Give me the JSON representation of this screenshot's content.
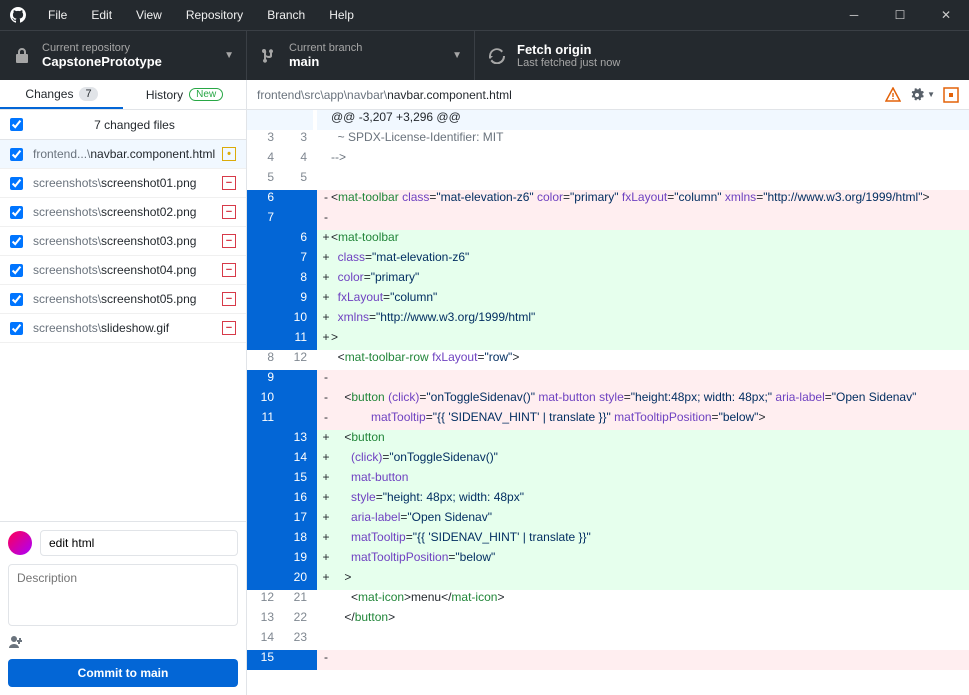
{
  "menu": [
    "File",
    "Edit",
    "View",
    "Repository",
    "Branch",
    "Help"
  ],
  "toolbar": {
    "repo_label": "Current repository",
    "repo_value": "CapstonePrototype",
    "branch_label": "Current branch",
    "branch_value": "main",
    "fetch_label": "Fetch origin",
    "fetch_value": "Last fetched just now"
  },
  "tabs": {
    "changes": "Changes",
    "changes_count": "7",
    "history": "History",
    "new_label": "New"
  },
  "files_header": "7 changed files",
  "files": [
    {
      "dim": "frontend...\\",
      "name": "navbar.component.html",
      "status": "modified"
    },
    {
      "dim": "screenshots\\",
      "name": "screenshot01.png",
      "status": "deleted"
    },
    {
      "dim": "screenshots\\",
      "name": "screenshot02.png",
      "status": "deleted"
    },
    {
      "dim": "screenshots\\",
      "name": "screenshot03.png",
      "status": "deleted"
    },
    {
      "dim": "screenshots\\",
      "name": "screenshot04.png",
      "status": "deleted"
    },
    {
      "dim": "screenshots\\",
      "name": "screenshot05.png",
      "status": "deleted"
    },
    {
      "dim": "screenshots\\",
      "name": "slideshow.gif",
      "status": "deleted"
    }
  ],
  "commit": {
    "summary_value": "edit html",
    "desc_placeholder": "Description",
    "button_prefix": "Commit to ",
    "button_branch": "main"
  },
  "path": {
    "dim": "frontend\\src\\app\\navbar\\",
    "file": "navbar.component.html"
  },
  "diff": [
    {
      "type": "hunk",
      "l": "",
      "r": "",
      "tokens": [
        {
          "c": "p",
          "t": "@@ -3,207 +3,296 @@"
        }
      ]
    },
    {
      "type": "ctx",
      "l": "3",
      "r": "3",
      "tokens": [
        {
          "c": "c",
          "t": "  ~ SPDX-License-Identifier: MIT"
        }
      ]
    },
    {
      "type": "ctx",
      "l": "4",
      "r": "4",
      "tokens": [
        {
          "c": "c",
          "t": "-->"
        }
      ]
    },
    {
      "type": "ctx",
      "l": "5",
      "r": "5",
      "tokens": []
    },
    {
      "type": "del",
      "l": "6",
      "r": "",
      "tokens": [
        {
          "c": "p",
          "t": "<"
        },
        {
          "c": "t",
          "t": "mat-toolbar"
        },
        {
          "c": "p",
          "t": " "
        },
        {
          "c": "a",
          "t": "class"
        },
        {
          "c": "p",
          "t": "="
        },
        {
          "c": "s",
          "t": "\"mat-elevation-z6\""
        },
        {
          "c": "p",
          "t": " "
        },
        {
          "c": "a",
          "t": "color"
        },
        {
          "c": "p",
          "t": "="
        },
        {
          "c": "s",
          "t": "\"primary\""
        },
        {
          "c": "p",
          "t": " "
        },
        {
          "c": "a",
          "t": "fxLayout"
        },
        {
          "c": "p",
          "t": "="
        },
        {
          "c": "s",
          "t": "\"column\""
        },
        {
          "c": "p",
          "t": " "
        },
        {
          "c": "a",
          "t": "xmlns"
        },
        {
          "c": "p",
          "t": "="
        },
        {
          "c": "s",
          "t": "\"http://www.w3.org/1999/html\""
        },
        {
          "c": "p",
          "t": ">"
        }
      ]
    },
    {
      "type": "del",
      "l": "7",
      "r": "",
      "tokens": []
    },
    {
      "type": "add",
      "l": "",
      "r": "6",
      "tokens": [
        {
          "c": "p",
          "t": "<"
        },
        {
          "c": "t",
          "t": "mat-toolbar"
        }
      ]
    },
    {
      "type": "add",
      "l": "",
      "r": "7",
      "tokens": [
        {
          "c": "p",
          "t": "  "
        },
        {
          "c": "a",
          "t": "class"
        },
        {
          "c": "p",
          "t": "="
        },
        {
          "c": "s",
          "t": "\"mat-elevation-z6\""
        }
      ]
    },
    {
      "type": "add",
      "l": "",
      "r": "8",
      "tokens": [
        {
          "c": "p",
          "t": "  "
        },
        {
          "c": "a",
          "t": "color"
        },
        {
          "c": "p",
          "t": "="
        },
        {
          "c": "s",
          "t": "\"primary\""
        }
      ]
    },
    {
      "type": "add",
      "l": "",
      "r": "9",
      "tokens": [
        {
          "c": "p",
          "t": "  "
        },
        {
          "c": "a",
          "t": "fxLayout"
        },
        {
          "c": "p",
          "t": "="
        },
        {
          "c": "s",
          "t": "\"column\""
        }
      ]
    },
    {
      "type": "add",
      "l": "",
      "r": "10",
      "tokens": [
        {
          "c": "p",
          "t": "  "
        },
        {
          "c": "a",
          "t": "xmlns"
        },
        {
          "c": "p",
          "t": "="
        },
        {
          "c": "s",
          "t": "\"http://www.w3.org/1999/html\""
        }
      ]
    },
    {
      "type": "add",
      "l": "",
      "r": "11",
      "tokens": [
        {
          "c": "p",
          "t": ">"
        }
      ]
    },
    {
      "type": "ctx",
      "l": "8",
      "r": "12",
      "tokens": [
        {
          "c": "p",
          "t": "  <"
        },
        {
          "c": "t",
          "t": "mat-toolbar-row"
        },
        {
          "c": "p",
          "t": " "
        },
        {
          "c": "a",
          "t": "fxLayout"
        },
        {
          "c": "p",
          "t": "="
        },
        {
          "c": "s",
          "t": "\"row\""
        },
        {
          "c": "p",
          "t": ">"
        }
      ]
    },
    {
      "type": "del",
      "l": "9",
      "r": "",
      "tokens": []
    },
    {
      "type": "del",
      "l": "10",
      "r": "",
      "tokens": [
        {
          "c": "p",
          "t": "    <"
        },
        {
          "c": "t",
          "t": "button"
        },
        {
          "c": "p",
          "t": " "
        },
        {
          "c": "a",
          "t": "(click)"
        },
        {
          "c": "p",
          "t": "="
        },
        {
          "c": "s",
          "t": "\"onToggleSidenav()\""
        },
        {
          "c": "p",
          "t": " "
        },
        {
          "c": "a",
          "t": "mat-button"
        },
        {
          "c": "p",
          "t": " "
        },
        {
          "c": "a",
          "t": "style"
        },
        {
          "c": "p",
          "t": "="
        },
        {
          "c": "s",
          "t": "\"height:48px; width: 48px;\""
        },
        {
          "c": "p",
          "t": " "
        },
        {
          "c": "a",
          "t": "aria-label"
        },
        {
          "c": "p",
          "t": "="
        },
        {
          "c": "s",
          "t": "\"Open Sidenav\""
        }
      ]
    },
    {
      "type": "del",
      "l": "11",
      "r": "",
      "tokens": [
        {
          "c": "p",
          "t": "            "
        },
        {
          "c": "a",
          "t": "matTooltip"
        },
        {
          "c": "p",
          "t": "="
        },
        {
          "c": "s",
          "t": "\"{{ 'SIDENAV_HINT' | translate }}\""
        },
        {
          "c": "p",
          "t": " "
        },
        {
          "c": "a",
          "t": "matTooltipPosition"
        },
        {
          "c": "p",
          "t": "="
        },
        {
          "c": "s",
          "t": "\"below\""
        },
        {
          "c": "p",
          "t": ">"
        }
      ]
    },
    {
      "type": "add",
      "l": "",
      "r": "13",
      "tokens": [
        {
          "c": "p",
          "t": "    <"
        },
        {
          "c": "t",
          "t": "button"
        }
      ]
    },
    {
      "type": "add",
      "l": "",
      "r": "14",
      "tokens": [
        {
          "c": "p",
          "t": "      "
        },
        {
          "c": "a",
          "t": "(click)"
        },
        {
          "c": "p",
          "t": "="
        },
        {
          "c": "s",
          "t": "\"onToggleSidenav()\""
        }
      ]
    },
    {
      "type": "add",
      "l": "",
      "r": "15",
      "tokens": [
        {
          "c": "p",
          "t": "      "
        },
        {
          "c": "a",
          "t": "mat-button"
        }
      ]
    },
    {
      "type": "add",
      "l": "",
      "r": "16",
      "tokens": [
        {
          "c": "p",
          "t": "      "
        },
        {
          "c": "a",
          "t": "style"
        },
        {
          "c": "p",
          "t": "="
        },
        {
          "c": "s",
          "t": "\"height: 48px; width: 48px\""
        }
      ]
    },
    {
      "type": "add",
      "l": "",
      "r": "17",
      "tokens": [
        {
          "c": "p",
          "t": "      "
        },
        {
          "c": "a",
          "t": "aria-label"
        },
        {
          "c": "p",
          "t": "="
        },
        {
          "c": "s",
          "t": "\"Open Sidenav\""
        }
      ]
    },
    {
      "type": "add",
      "l": "",
      "r": "18",
      "tokens": [
        {
          "c": "p",
          "t": "      "
        },
        {
          "c": "a",
          "t": "matTooltip"
        },
        {
          "c": "p",
          "t": "="
        },
        {
          "c": "s",
          "t": "\"{{ 'SIDENAV_HINT' | translate }}\""
        }
      ]
    },
    {
      "type": "add",
      "l": "",
      "r": "19",
      "tokens": [
        {
          "c": "p",
          "t": "      "
        },
        {
          "c": "a",
          "t": "matTooltipPosition"
        },
        {
          "c": "p",
          "t": "="
        },
        {
          "c": "s",
          "t": "\"below\""
        }
      ]
    },
    {
      "type": "add",
      "l": "",
      "r": "20",
      "tokens": [
        {
          "c": "p",
          "t": "    >"
        }
      ]
    },
    {
      "type": "ctx",
      "l": "12",
      "r": "21",
      "tokens": [
        {
          "c": "p",
          "t": "      <"
        },
        {
          "c": "t",
          "t": "mat-icon"
        },
        {
          "c": "p",
          "t": ">menu</"
        },
        {
          "c": "t",
          "t": "mat-icon"
        },
        {
          "c": "p",
          "t": ">"
        }
      ]
    },
    {
      "type": "ctx",
      "l": "13",
      "r": "22",
      "tokens": [
        {
          "c": "p",
          "t": "    </"
        },
        {
          "c": "t",
          "t": "button"
        },
        {
          "c": "p",
          "t": ">"
        }
      ]
    },
    {
      "type": "ctx",
      "l": "14",
      "r": "23",
      "tokens": []
    },
    {
      "type": "del",
      "l": "15",
      "r": "",
      "tokens": []
    }
  ]
}
